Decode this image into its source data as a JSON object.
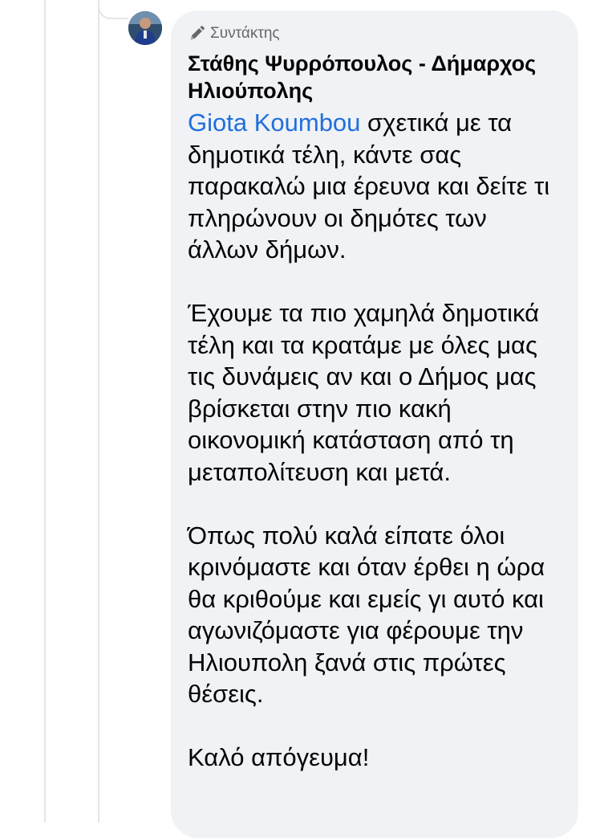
{
  "comment": {
    "badge_label": "Συντάκτης",
    "badge_icon": "pencil-icon",
    "author_name": "Στάθης Ψυρρόπουλος - Δήμαρχος Ηλιούπολης",
    "mention": "Giota Koumbou",
    "paragraph_1_rest": " σχετικά με τα δημοτικά τέλη, κάντε σας παρακαλώ μια έρευνα και δείτε τι πληρώνουν οι δημότες των άλλων δήμων.",
    "paragraph_2": "Έχουμε τα πιο χαμηλά δημοτικά τέλη και τα κρατάμε με όλες μας τις δυνάμεις αν και ο Δήμος μας βρίσκεται στην πιο κακή οικονομική κατάσταση από τη μεταπολίτευση και μετά.",
    "paragraph_3": "Όπως πολύ καλά είπατε όλοι κρινόμαστε και όταν έρθει η ώρα θα κριθούμε και εμείς γι αυτό και αγωνιζόμαστε για φέρουμε την Ηλιουπολη ξανά στις πρώτες θέσεις.",
    "paragraph_4": "Καλό απόγευμα!"
  },
  "colors": {
    "bubble_background": "#f0f2f5",
    "mention_link": "#216fdb",
    "badge_text": "#65676b",
    "thread_line": "#e4e6eb"
  }
}
